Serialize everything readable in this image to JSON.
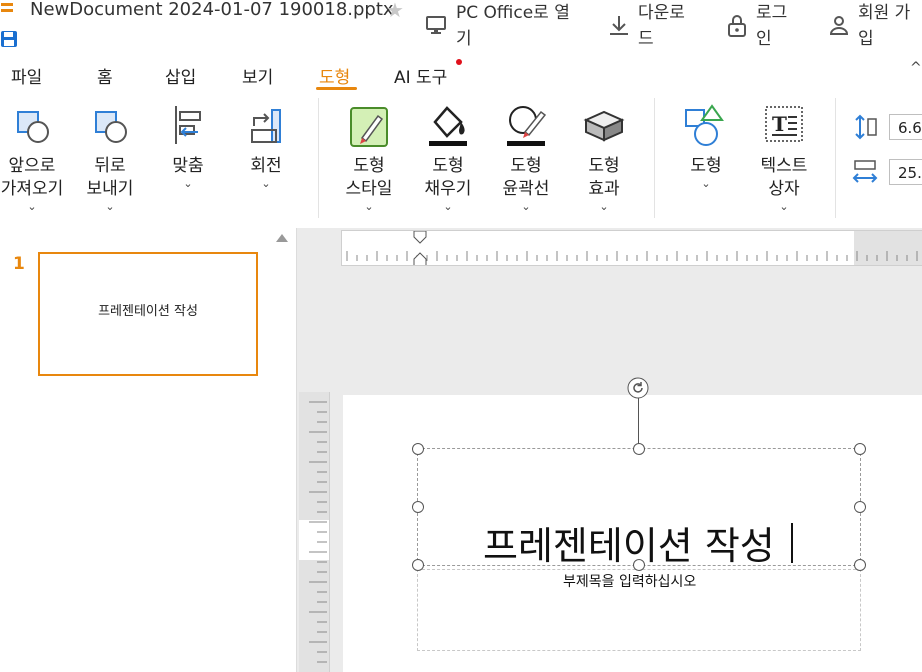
{
  "titlebar": {
    "doc_title": "NewDocument 2024-01-07 190018.pptx",
    "pc_office_open": "PC Office로 열기",
    "download": "다운로드",
    "login": "로그인",
    "signup": "회원 가입"
  },
  "tabs": [
    {
      "label": "파일"
    },
    {
      "label": "홈"
    },
    {
      "label": "삽입"
    },
    {
      "label": "보기"
    },
    {
      "label": "도형"
    },
    {
      "label": "AI 도구"
    }
  ],
  "ribbon": {
    "bring_forward": [
      "앞으로",
      "가져오기"
    ],
    "send_backward": [
      "뒤로",
      "보내기"
    ],
    "align": "맞춤",
    "rotate": "회전",
    "shape_style": [
      "도형",
      "스타일"
    ],
    "shape_fill": [
      "도형",
      "채우기"
    ],
    "shape_outline": [
      "도형",
      "윤곽선"
    ],
    "shape_effect": [
      "도형",
      "효과"
    ],
    "shape": "도형",
    "text_box": [
      "텍스트",
      "상자"
    ],
    "height_value": "6.6",
    "width_value": "25."
  },
  "slides_panel": {
    "slide_number": "1",
    "thumb_title": "프레젠테이션 작성"
  },
  "slide": {
    "title": "프레젠테이션 작성",
    "subtitle_placeholder": "부제목을 입력하십시오"
  },
  "colors": {
    "accent": "#e8870e",
    "badge": "#e0101b"
  }
}
